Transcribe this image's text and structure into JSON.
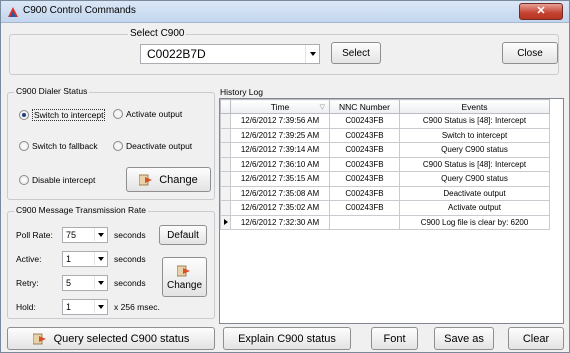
{
  "window": {
    "title": "C900 Control Commands",
    "close_glyph": "✕"
  },
  "select_c900": {
    "group_label": "Select C900",
    "value": "C0022B7D",
    "select_label": "Select",
    "close_label": "Close"
  },
  "dialer_status": {
    "group_label": "C900 Dialer Status",
    "options": [
      {
        "label": "Switch to intercept",
        "selected": true
      },
      {
        "label": "Activate output",
        "selected": false
      },
      {
        "label": "Switch to fallback",
        "selected": false
      },
      {
        "label": "Deactivate output",
        "selected": false
      },
      {
        "label": "Disable intercept",
        "selected": false
      }
    ],
    "change_label": "Change"
  },
  "transmission_rate": {
    "group_label": "C900 Message Transmission Rate",
    "poll_rate": {
      "label": "Poll Rate:",
      "value": "75",
      "unit": "seconds"
    },
    "active": {
      "label": "Active:",
      "value": "1",
      "unit": "seconds"
    },
    "retry": {
      "label": "Retry:",
      "value": "5",
      "unit": "seconds"
    },
    "hold": {
      "label": "Hold:",
      "value": "1",
      "unit": "x 256 msec."
    },
    "default_label": "Default",
    "change_label": "Change"
  },
  "query_label": "Query selected C900 status",
  "history": {
    "group_label": "History Log",
    "columns": [
      "Time",
      "NNC Number",
      "Events"
    ],
    "rows": [
      {
        "time": "12/6/2012 7:39:56 AM",
        "nnc": "C00243FB",
        "event": "C900 Status is [48]: Intercept"
      },
      {
        "time": "12/6/2012 7:39:25 AM",
        "nnc": "C00243FB",
        "event": "Switch to intercept"
      },
      {
        "time": "12/6/2012 7:39:14 AM",
        "nnc": "C00243FB",
        "event": "Query C900 status"
      },
      {
        "time": "12/6/2012 7:36:10 AM",
        "nnc": "C00243FB",
        "event": "C900 Status is [48]: Intercept"
      },
      {
        "time": "12/6/2012 7:35:15 AM",
        "nnc": "C00243FB",
        "event": "Query C900 status"
      },
      {
        "time": "12/6/2012 7:35:08 AM",
        "nnc": "C00243FB",
        "event": "Deactivate output"
      },
      {
        "time": "12/6/2012 7:35:02 AM",
        "nnc": "C00243FB",
        "event": "Activate output"
      },
      {
        "time": "12/6/2012 7:32:30 AM",
        "nnc": "",
        "event": "C900 Log file is clear by: 6200"
      }
    ]
  },
  "bottom_buttons": {
    "explain": "Explain C900 status",
    "font": "Font",
    "save_as": "Save as",
    "clear": "Clear"
  },
  "colors": {
    "title_bar": "#c3d6ee",
    "window_bg": "#f0f0f0",
    "close_red": "#c44130"
  },
  "icons": [
    "app-icon",
    "change-arrow-icon",
    "query-arrow-icon",
    "row-pointer-icon",
    "sort-icon"
  ]
}
